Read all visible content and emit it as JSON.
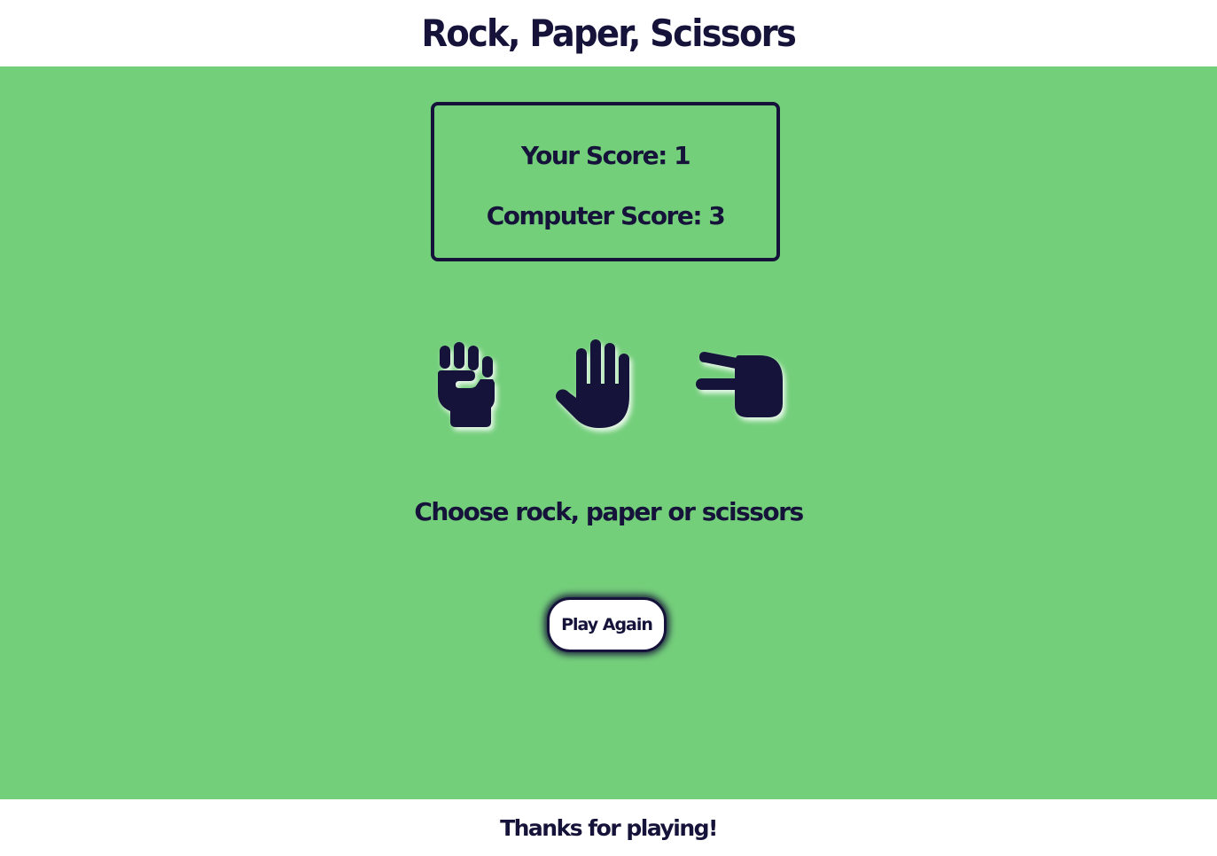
{
  "header": {
    "title": "Rock, Paper, Scissors"
  },
  "scoreboard": {
    "player": "Your Score: 1",
    "computer": "Computer Score: 3"
  },
  "choices": [
    {
      "name": "rock",
      "icon": "fist-icon"
    },
    {
      "name": "paper",
      "icon": "hand-icon"
    },
    {
      "name": "scissors",
      "icon": "hand-scissors-icon"
    }
  ],
  "message": "Choose rock, paper or scissors",
  "play_again_label": "Play Again",
  "footer": {
    "text": "Thanks for playing!"
  },
  "colors": {
    "background": "#74cf7b",
    "ink": "#16133a",
    "surface": "#ffffff"
  }
}
